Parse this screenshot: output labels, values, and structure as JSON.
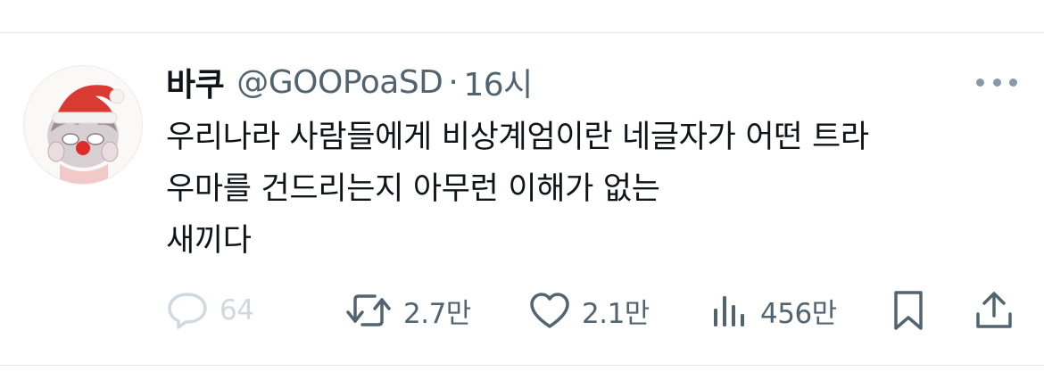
{
  "tweet": {
    "display_name": "바쿠",
    "handle": "@GOOPoaSD",
    "separator": "·",
    "time": "16시",
    "text_lines": [
      "우리나라 사람들에게 비상계엄이란 네글자가 어떤 트라",
      "우마를 건드리는지 아무런 이해가 없는",
      "새끼다"
    ]
  },
  "actions": {
    "reply_count": "64",
    "retweet_count": "2.7만",
    "like_count": "2.1만",
    "views_count": "456만"
  },
  "icons": {
    "avatar": "santa-hat-avatar",
    "more": "more-dots-icon",
    "reply": "reply-bubble-icon",
    "retweet": "retweet-icon",
    "like": "heart-icon",
    "views": "views-bars-icon",
    "bookmark": "bookmark-icon",
    "share": "share-icon"
  },
  "colors": {
    "text": "#0f1419",
    "secondary": "#536471",
    "disabled": "#cfd9de",
    "divider": "#e6e9ec"
  }
}
